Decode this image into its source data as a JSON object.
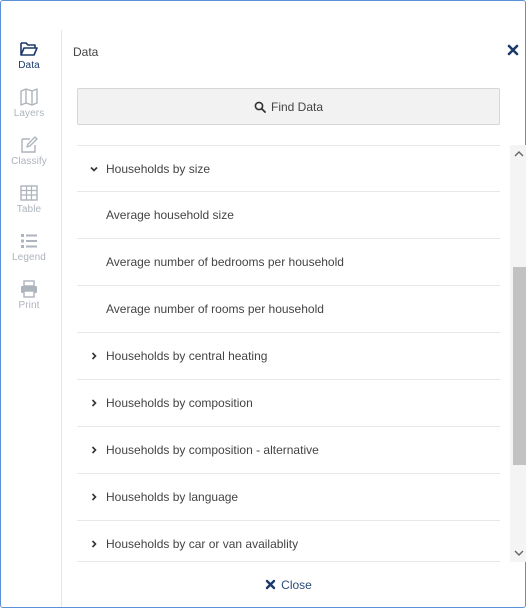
{
  "toolbar": {
    "items": [
      {
        "label": "Data",
        "icon": "folder-open-icon",
        "active": true
      },
      {
        "label": "Layers",
        "icon": "map-icon",
        "active": false
      },
      {
        "label": "Classify",
        "icon": "edit-icon",
        "active": false
      },
      {
        "label": "Table",
        "icon": "table-icon",
        "active": false
      },
      {
        "label": "Legend",
        "icon": "list-icon",
        "active": false
      },
      {
        "label": "Print",
        "icon": "printer-icon",
        "active": false
      }
    ]
  },
  "panel": {
    "title": "Data",
    "find_label": "Find Data",
    "close_label": "Close"
  },
  "list": {
    "items": [
      {
        "label": "Households by size",
        "type": "group",
        "expanded": true
      },
      {
        "label": "Average household size",
        "type": "item"
      },
      {
        "label": "Average number of bedrooms per household",
        "type": "item"
      },
      {
        "label": "Average number of rooms per household",
        "type": "item"
      },
      {
        "label": "Households by central heating",
        "type": "group",
        "expanded": false
      },
      {
        "label": "Households by composition",
        "type": "group",
        "expanded": false
      },
      {
        "label": "Households by composition - alternative",
        "type": "group",
        "expanded": false
      },
      {
        "label": "Households by language",
        "type": "group",
        "expanded": false
      },
      {
        "label": "Households by car or van availablity",
        "type": "group",
        "expanded": false
      }
    ]
  },
  "colors": {
    "accent": "#1b3a6b",
    "inactive_icon": "#aeb4bc",
    "frame_border": "#5b8fd6"
  }
}
